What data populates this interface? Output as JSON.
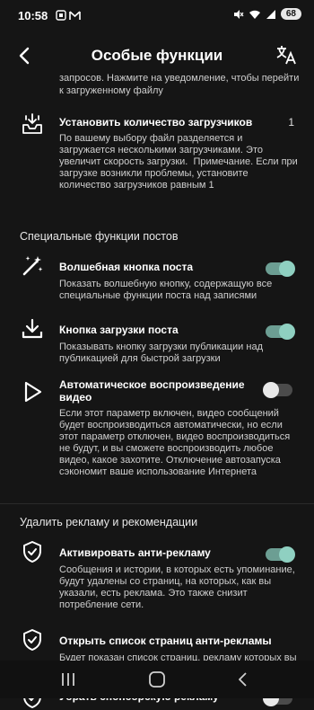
{
  "status": {
    "time": "10:58",
    "battery": "68"
  },
  "appbar": {
    "title": "Особые функции"
  },
  "intro_text": "запросов. Нажмите на уведомление, чтобы перейти к загруженному файлу",
  "downloaders": {
    "title": "Установить количество загрузчиков",
    "value": "1",
    "desc": "По вашему выбору файл разделяется и загружается несколькими загрузчиками. Это увеличит скорость загрузки.  Примечание. Если при загрузке возникли проблемы, установите количество загрузчиков равным 1"
  },
  "sections": {
    "posts": "Специальные функции постов",
    "ads": "Удалить рекламу и рекомендации"
  },
  "items": {
    "magic": {
      "title": "Волшебная кнопка поста",
      "desc": "Показать волшебную кнопку, содержащую все специальные функции поста над записями",
      "enabled": true
    },
    "download": {
      "title": "Кнопка загрузки поста",
      "desc": "Показывать кнопку загрузки публикации над публикацией для быстрой загрузки",
      "enabled": true
    },
    "autoplay": {
      "title": "Автоматическое воспроизведение видео",
      "desc": "Если этот параметр включен, видео сообщений будет воспроизводиться автоматически, но если этот параметр отключен, видео воспроизводиться не будут, и вы сможете воспроизводить любое видео, какое захотите. Отключение автозапуска сэкономит ваше использование Интернета",
      "enabled": false
    },
    "antiads": {
      "title": "Активировать анти-рекламу",
      "desc": "Сообщения и истории, в которых есть упоминание, будут удалены со страниц, на которых, как вы указали, есть реклама. Это также снизит потребление сети.",
      "enabled": true
    },
    "antiads_list": {
      "title": "Открыть список страниц анти-рекламы",
      "desc": "Будет показан список страниц, рекламу которых вы хотите удалить"
    },
    "sponsored": {
      "title": "Убрать спонсорскую рекламу",
      "enabled": false
    }
  }
}
